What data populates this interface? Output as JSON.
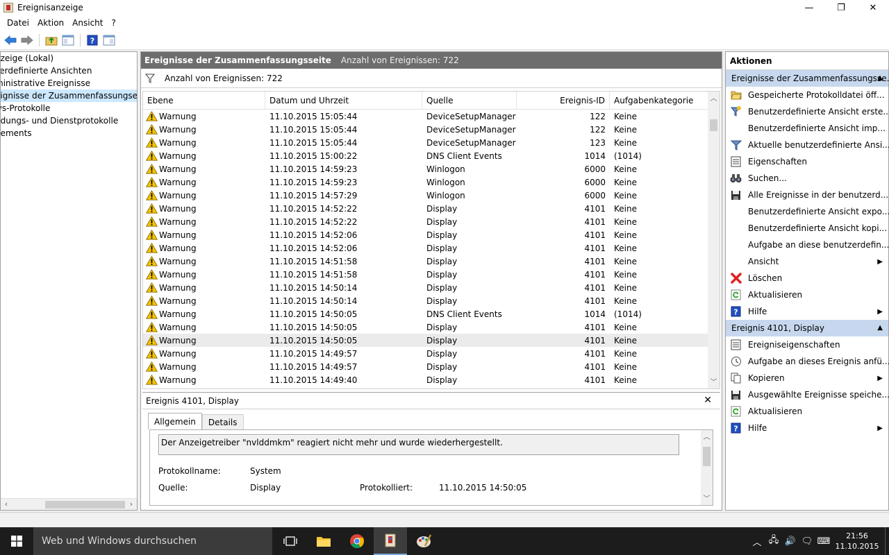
{
  "window": {
    "title": "Ereignisanzeige",
    "minimize": "—",
    "maximize": "❐",
    "close": "✕"
  },
  "menu": [
    "Datei",
    "Aktion",
    "Ansicht",
    "?"
  ],
  "tree": [
    {
      "label": "Ereignisanzeige (Lokal)",
      "visible": "nzeige (Lokal)"
    },
    {
      "label": "Benutzerdefinierte Ansichten",
      "visible": "zerdefinierte Ansichten"
    },
    {
      "label": "Administrative Ereignisse",
      "visible": "ministrative Ereignisse"
    },
    {
      "label": "Ereignisse der Zusammenfassungsseite",
      "visible": "eignisse der Zusammenfassungseite"
    },
    {
      "label": "Windows-Protokolle",
      "visible": "ws-Protokolle"
    },
    {
      "label": "Anwendungs- und Dienstprotokolle",
      "visible": "ndungs- und Dienstprotokolle"
    },
    {
      "label": "Abonnements",
      "visible": "nements"
    }
  ],
  "center": {
    "title": "Ereignisse der Zusammenfassungsseite",
    "count": "Anzahl von Ereignissen: 722",
    "filter_label": "Anzahl von Ereignissen: 722",
    "columns": [
      "Ebene",
      "Datum und Uhrzeit",
      "Quelle",
      "Ereignis-ID",
      "Aufgabenkategorie"
    ],
    "rows": [
      [
        "Warnung",
        "11.10.2015 15:05:44",
        "DeviceSetupManager",
        "122",
        "Keine"
      ],
      [
        "Warnung",
        "11.10.2015 15:05:44",
        "DeviceSetupManager",
        "122",
        "Keine"
      ],
      [
        "Warnung",
        "11.10.2015 15:05:44",
        "DeviceSetupManager",
        "123",
        "Keine"
      ],
      [
        "Warnung",
        "11.10.2015 15:00:22",
        "DNS Client Events",
        "1014",
        "(1014)"
      ],
      [
        "Warnung",
        "11.10.2015 14:59:23",
        "Winlogon",
        "6000",
        "Keine"
      ],
      [
        "Warnung",
        "11.10.2015 14:59:23",
        "Winlogon",
        "6000",
        "Keine"
      ],
      [
        "Warnung",
        "11.10.2015 14:57:29",
        "Winlogon",
        "6000",
        "Keine"
      ],
      [
        "Warnung",
        "11.10.2015 14:52:22",
        "Display",
        "4101",
        "Keine"
      ],
      [
        "Warnung",
        "11.10.2015 14:52:22",
        "Display",
        "4101",
        "Keine"
      ],
      [
        "Warnung",
        "11.10.2015 14:52:06",
        "Display",
        "4101",
        "Keine"
      ],
      [
        "Warnung",
        "11.10.2015 14:52:06",
        "Display",
        "4101",
        "Keine"
      ],
      [
        "Warnung",
        "11.10.2015 14:51:58",
        "Display",
        "4101",
        "Keine"
      ],
      [
        "Warnung",
        "11.10.2015 14:51:58",
        "Display",
        "4101",
        "Keine"
      ],
      [
        "Warnung",
        "11.10.2015 14:50:14",
        "Display",
        "4101",
        "Keine"
      ],
      [
        "Warnung",
        "11.10.2015 14:50:14",
        "Display",
        "4101",
        "Keine"
      ],
      [
        "Warnung",
        "11.10.2015 14:50:05",
        "DNS Client Events",
        "1014",
        "(1014)"
      ],
      [
        "Warnung",
        "11.10.2015 14:50:05",
        "Display",
        "4101",
        "Keine"
      ],
      [
        "Warnung",
        "11.10.2015 14:50:05",
        "Display",
        "4101",
        "Keine"
      ],
      [
        "Warnung",
        "11.10.2015 14:49:57",
        "Display",
        "4101",
        "Keine"
      ],
      [
        "Warnung",
        "11.10.2015 14:49:57",
        "Display",
        "4101",
        "Keine"
      ],
      [
        "Warnung",
        "11.10.2015 14:49:40",
        "Display",
        "4101",
        "Keine"
      ]
    ],
    "selected_row": 17
  },
  "detail": {
    "title": "Ereignis 4101, Display",
    "tabs": [
      "Allgemein",
      "Details"
    ],
    "message": "Der Anzeigetreiber \"nvlddmkm\" reagiert nicht mehr und wurde wiederhergestellt.",
    "protokollname_label": "Protokollname:",
    "protokollname_value": "System",
    "quelle_label": "Quelle:",
    "quelle_value": "Display",
    "protokolliert_label": "Protokolliert:",
    "protokolliert_value": "11.10.2015 14:50:05"
  },
  "actions": {
    "title": "Aktionen",
    "section1": "Ereignisse der Zusammenfassungsse...",
    "items1": [
      {
        "label": "Gespeicherte Protokolldatei öff...",
        "icon": "folder-open-icon"
      },
      {
        "label": "Benutzerdefinierte Ansicht erste...",
        "icon": "filter-star-icon"
      },
      {
        "label": "Benutzerdefinierte Ansicht imp...",
        "icon": ""
      },
      {
        "label": "Aktuelle benutzerdefinierte Ansi...",
        "icon": "filter-icon"
      },
      {
        "label": "Eigenschaften",
        "icon": "properties-icon"
      },
      {
        "label": "Suchen...",
        "icon": "binoculars-icon"
      },
      {
        "label": "Alle Ereignisse in der benutzerd...",
        "icon": "save-icon"
      },
      {
        "label": "Benutzerdefinierte Ansicht expo...",
        "icon": ""
      },
      {
        "label": "Benutzerdefinierte Ansicht kopi...",
        "icon": ""
      },
      {
        "label": "Aufgabe an diese benutzerdefin...",
        "icon": ""
      },
      {
        "label": "Ansicht",
        "icon": "",
        "submenu": true
      },
      {
        "label": "Löschen",
        "icon": "delete-icon"
      },
      {
        "label": "Aktualisieren",
        "icon": "refresh-icon"
      },
      {
        "label": "Hilfe",
        "icon": "help-icon",
        "submenu": true
      }
    ],
    "section2": "Ereignis 4101, Display",
    "items2": [
      {
        "label": "Ereigniseigenschaften",
        "icon": "properties-icon"
      },
      {
        "label": "Aufgabe an dieses Ereignis anfü...",
        "icon": "task-icon"
      },
      {
        "label": "Kopieren",
        "icon": "copy-icon",
        "submenu": true
      },
      {
        "label": "Ausgewählte Ereignisse speiche...",
        "icon": "save-icon"
      },
      {
        "label": "Aktualisieren",
        "icon": "refresh-icon"
      },
      {
        "label": "Hilfe",
        "icon": "help-icon",
        "submenu": true
      }
    ]
  },
  "taskbar": {
    "search_placeholder": "Web und Windows durchsuchen",
    "time": "21:56",
    "date": "11.10.2015"
  }
}
